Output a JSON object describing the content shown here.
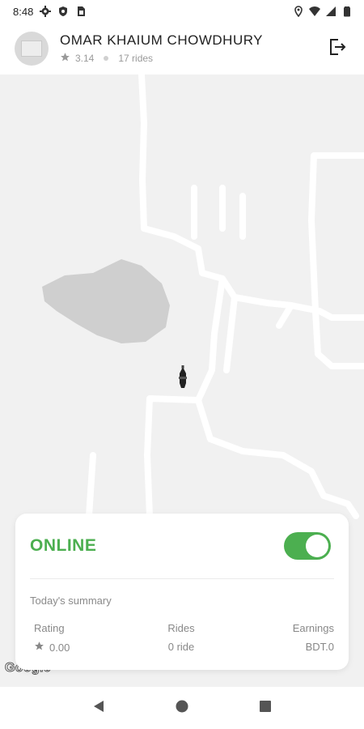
{
  "status_bar": {
    "time": "8:48",
    "left_icons": [
      "gear-icon",
      "shield-icon",
      "sim-card-icon"
    ],
    "right_icons": [
      "location-icon",
      "wifi-icon",
      "signal-icon",
      "battery-icon"
    ]
  },
  "header": {
    "driver_name": "OMAR KHAIUM CHOWDHURY",
    "rating": "3.14",
    "rides": "17 rides"
  },
  "map": {
    "attribution": "Google"
  },
  "card": {
    "status": "ONLINE",
    "toggle_on": true,
    "summary_title": "Today's summary",
    "stats": [
      {
        "label": "Rating",
        "value": "0.00"
      },
      {
        "label": "Rides",
        "value": "0 ride"
      },
      {
        "label": "Earnings",
        "value": "BDT.0"
      }
    ]
  },
  "colors": {
    "accent": "#4caf50",
    "map_bg": "#f1f1f1",
    "map_road": "#ffffff",
    "map_area": "#cfcfcf"
  },
  "nav": {
    "buttons": [
      "back-icon",
      "home-icon",
      "recents-icon"
    ]
  }
}
